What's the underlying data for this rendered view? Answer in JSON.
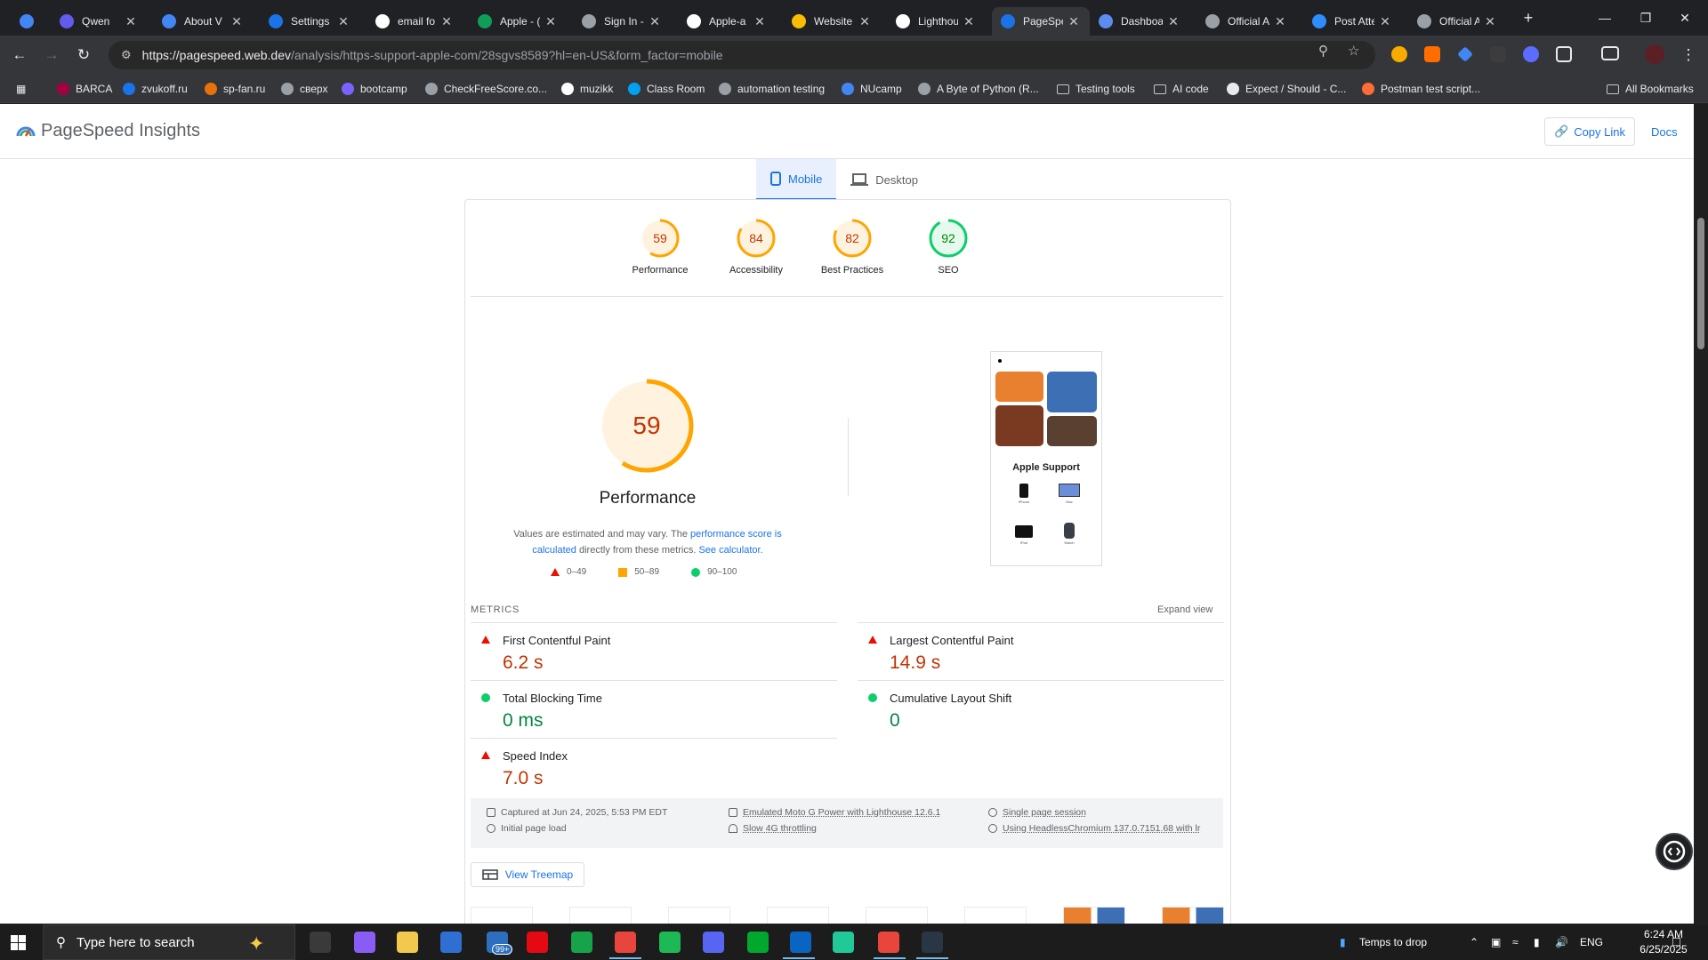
{
  "browser": {
    "tabs": [
      {
        "title": "",
        "color": "#4285f4",
        "icon": "gem-icon"
      },
      {
        "title": "Qwen",
        "color": "#615ced",
        "icon": "qwen-icon"
      },
      {
        "title": "About V",
        "color": "#4285f4",
        "icon": "chrome-icon"
      },
      {
        "title": "Settings",
        "color": "#1a73e8",
        "icon": "gear-icon"
      },
      {
        "title": "email fo",
        "color": "#ffffff",
        "icon": "google-icon"
      },
      {
        "title": "Apple - (",
        "color": "#0f9d58",
        "icon": "sheets-icon"
      },
      {
        "title": "Sign In -",
        "color": "#9aa0a6",
        "icon": "apple-icon"
      },
      {
        "title": "Apple-a",
        "color": "#ffffff",
        "icon": "github-icon"
      },
      {
        "title": "Website",
        "color": "#fbbc04",
        "icon": "chrome-icon"
      },
      {
        "title": "Lighthou",
        "color": "#ffffff",
        "icon": "lighthouse-icon"
      },
      {
        "title": "PageSpe",
        "color": "#1a73e8",
        "icon": "pagespeed-icon"
      },
      {
        "title": "Dashboa",
        "color": "#5b8def",
        "icon": "dashboard-icon"
      },
      {
        "title": "Official A",
        "color": "#9aa0a6",
        "icon": "apple-icon"
      },
      {
        "title": "Post Atte",
        "color": "#2d8cff",
        "icon": "zoom-icon"
      },
      {
        "title": "Official A",
        "color": "#9aa0a6",
        "icon": "apple-icon"
      }
    ],
    "url_host": "https://pagespeed.web.dev",
    "url_path": "/analysis/https-support-apple-com/28sgvs8589?hl=en-US&form_factor=mobile",
    "bookmarks": [
      {
        "label": "BARCA",
        "color": "#a50044"
      },
      {
        "label": "zvukoff.ru",
        "color": "#1a73e8"
      },
      {
        "label": "sp-fan.ru",
        "color": "#e8710a"
      },
      {
        "label": "сверх",
        "color": "#9aa0a6"
      },
      {
        "label": "bootcamp",
        "color": "#7b61ff"
      },
      {
        "label": "CheckFreeScore.co...",
        "color": "#9aa0a6"
      },
      {
        "label": "muzikk",
        "color": "#ffffff"
      },
      {
        "label": "Class Room",
        "color": "#00a1f1"
      },
      {
        "label": "automation testing",
        "color": "#9aa0a6"
      },
      {
        "label": "NUcamp",
        "color": "#4285f4"
      },
      {
        "label": "A Byte of Python (R...",
        "color": "#9aa0a6"
      },
      {
        "label": "Testing tools",
        "folder": true
      },
      {
        "label": "AI code",
        "folder": true
      },
      {
        "label": "Expect / Should - C...",
        "color": "#e8eaed"
      },
      {
        "label": "Postman test script...",
        "color": "#ff6c37"
      }
    ],
    "all_bookmarks": "All Bookmarks"
  },
  "psi": {
    "title": "PageSpeed Insights",
    "copy_link": "Copy Link",
    "docs": "Docs",
    "tab_mobile": "Mobile",
    "tab_desktop": "Desktop",
    "scores": [
      {
        "label": "Performance",
        "value": "59",
        "fraction": 0.59,
        "color": "#ffa400",
        "text": "#c33300"
      },
      {
        "label": "Accessibility",
        "value": "84",
        "fraction": 0.84,
        "color": "#ffa400",
        "text": "#c33300"
      },
      {
        "label": "Best Practices",
        "value": "82",
        "fraction": 0.82,
        "color": "#ffa400",
        "text": "#c33300"
      },
      {
        "label": "SEO",
        "value": "92",
        "fraction": 0.92,
        "color": "#0cce6b",
        "text": "#008800"
      }
    ],
    "big_score": "59",
    "big_label": "Performance",
    "desc_1": "Values are estimated and may vary. The ",
    "desc_link_1": "performance score is calculated",
    "desc_2": " directly from these metrics. ",
    "desc_link_2": "See calculator.",
    "legend": [
      "0–49",
      "50–89",
      "90–100"
    ],
    "screenshot_caption": "Apple Support",
    "screenshot_items": [
      "iPhone",
      "Mac",
      "iPad",
      "Watch"
    ],
    "metrics_label": "METRICS",
    "expand_view": "Expand view",
    "metrics": [
      {
        "name": "First Contentful Paint",
        "value": "6.2 s",
        "status": "bad"
      },
      {
        "name": "Largest Contentful Paint",
        "value": "14.9 s",
        "status": "bad"
      },
      {
        "name": "Total Blocking Time",
        "value": "0 ms",
        "status": "good"
      },
      {
        "name": "Cumulative Layout Shift",
        "value": "0",
        "status": "good"
      },
      {
        "name": "Speed Index",
        "value": "7.0 s",
        "status": "bad"
      }
    ],
    "run_info": {
      "captured": "Captured at Jun 24, 2025, 5:53 PM EDT",
      "initial": "Initial page load",
      "device": "Emulated Moto G Power with Lighthouse 12.6.1",
      "throttling": "Slow 4G throttling",
      "session": "Single page session",
      "browser": "Using HeadlessChromium 137.0.7151.68 with lr"
    },
    "treemap": "View Treemap"
  },
  "taskbar": {
    "search_placeholder": "Type here to search",
    "temps": "Temps to drop",
    "lang": "ENG",
    "time": "6:24 AM",
    "date": "6/25/2025",
    "mail_badge": "99+"
  }
}
